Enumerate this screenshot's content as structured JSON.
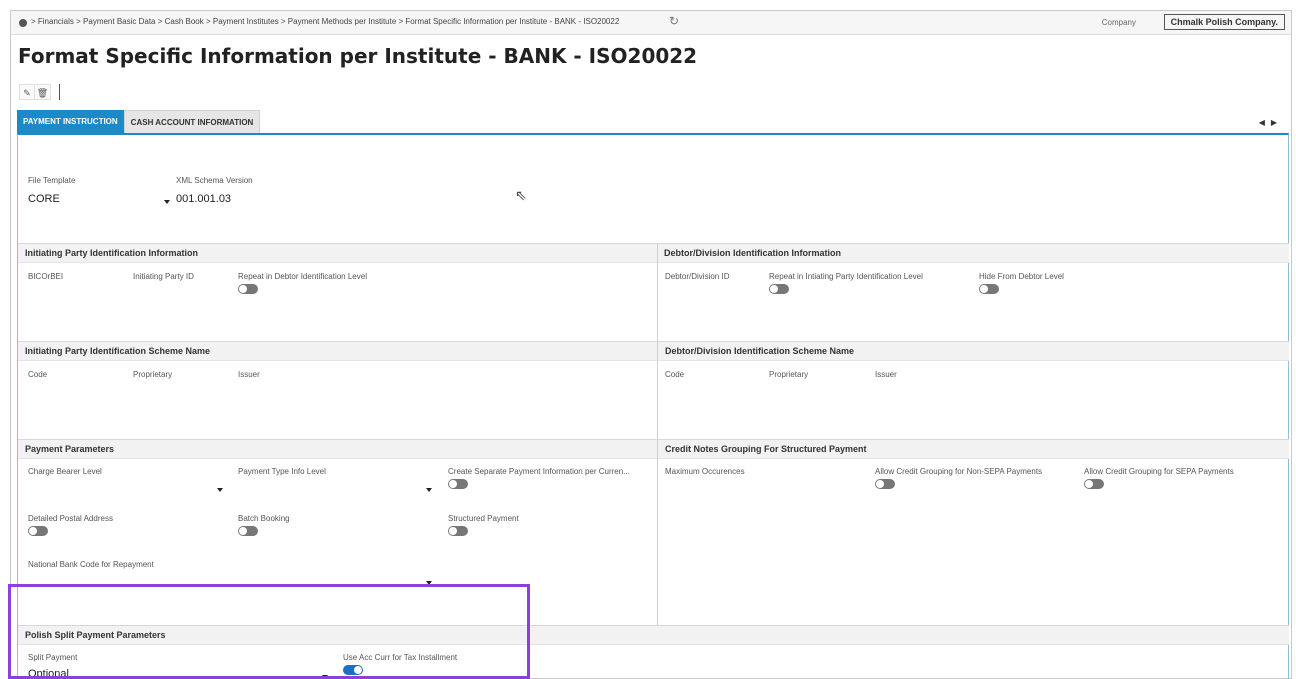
{
  "breadcrumb": {
    "text": "> Financials > Payment Basic Data > Cash Book > Payment Institutes > Payment Methods per Institute > Format Specific Information per Institute - BANK - ISO20022"
  },
  "company": {
    "label": "Company",
    "value": "Chmalk Polish Company."
  },
  "page": {
    "title": "Format Specific Information per Institute - BANK - ISO20022"
  },
  "tabs": [
    {
      "label": "PAYMENT INSTRUCTION",
      "active": true
    },
    {
      "label": "CASH ACCOUNT INFORMATION",
      "active": false
    }
  ],
  "header_fields": {
    "file_template": {
      "label": "File Template",
      "value": "CORE"
    },
    "xml_schema": {
      "label": "XML Schema Version",
      "value": "001.001.03"
    }
  },
  "initiating_party": {
    "title": "Initiating Party Identification Information",
    "f1": "BICOrBEI",
    "f2": "Initiating Party ID",
    "f3": "Repeat in Debtor Identification Level",
    "f3_on": false
  },
  "debtor_division": {
    "title": "Debtor/Division Identification Information",
    "f1": "Debtor/Division ID",
    "f2": "Repeat in Intiating Party Identification Level",
    "f2_on": false,
    "f3": "Hide From Debtor Level",
    "f3_on": false
  },
  "ip_scheme": {
    "title": "Initiating Party Identification Scheme Name",
    "code": "Code",
    "proprietary": "Proprietary",
    "issuer": "Issuer"
  },
  "dd_scheme": {
    "title": "Debtor/Division Identification Scheme Name",
    "code": "Code",
    "proprietary": "Proprietary",
    "issuer": "Issuer"
  },
  "payment_params": {
    "title": "Payment Parameters",
    "charge_bearer": "Charge Bearer Level",
    "payment_type": "Payment Type Info Level",
    "separate_payment": "Create Separate Payment Information per Curren...",
    "separate_payment_on": false,
    "postal_address": "Detailed Postal Address",
    "postal_address_on": false,
    "batch_booking": "Batch Booking",
    "batch_booking_on": false,
    "structured_payment": "Structured Payment",
    "structured_payment_on": false,
    "national_bank_code": "National Bank Code for Repayment"
  },
  "credit_notes": {
    "title": "Credit Notes Grouping For Structured Payment",
    "max_occ": "Maximum Occurences",
    "non_sepa": "Allow Credit Grouping for Non-SEPA Payments",
    "non_sepa_on": false,
    "sepa": "Allow Credit Grouping for SEPA Payments",
    "sepa_on": false
  },
  "polish_split": {
    "title": "Polish Split Payment Parameters",
    "split_payment_label": "Split Payment",
    "split_payment_value": "Optional",
    "use_acc_curr": "Use Acc Curr for Tax Installment",
    "use_acc_curr_on": true
  },
  "colors": {
    "accent": "#1b8ac7",
    "highlight": "#8e3fd8",
    "toggle_on": "#1b6fc4",
    "toggle_off": "#777777"
  }
}
